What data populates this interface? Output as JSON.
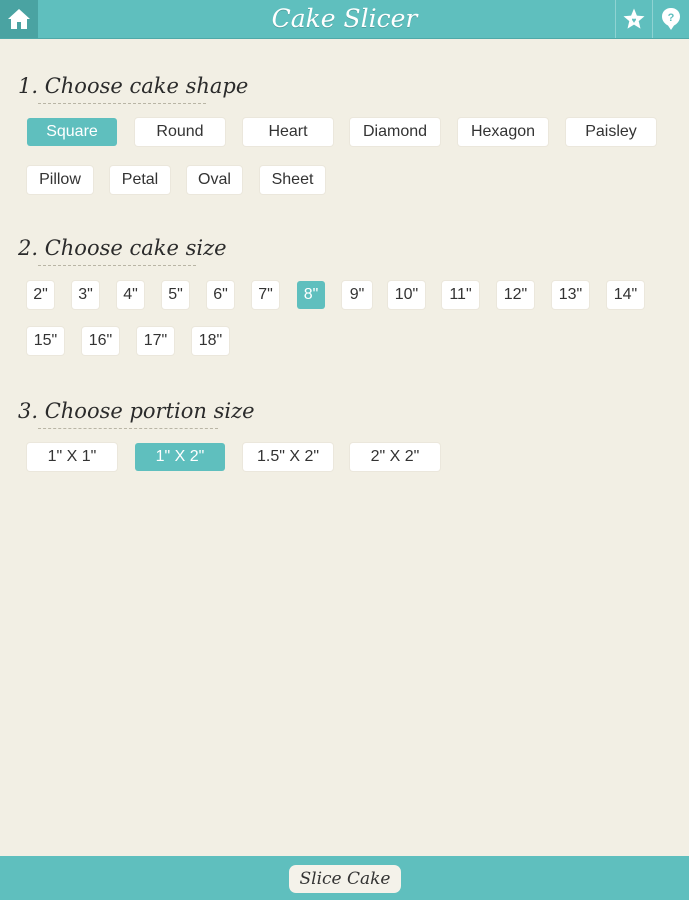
{
  "app": {
    "title": "Cake Slicer",
    "home_icon": "home-icon",
    "favorites_icon": "star-icon",
    "help_icon": "help-icon"
  },
  "colors": {
    "accent": "#5fbfbe",
    "background": "#f2efe4",
    "accent_dark": "#4aa3a2"
  },
  "shape": {
    "title": "1. Choose cake shape",
    "options": [
      "Square",
      "Round",
      "Heart",
      "Diamond",
      "Hexagon",
      "Paisley",
      "Pillow",
      "Petal",
      "Oval",
      "Sheet"
    ],
    "selected": "Square"
  },
  "size": {
    "title": "2. Choose cake size",
    "options": [
      "2\"",
      "3\"",
      "4\"",
      "5\"",
      "6\"",
      "7\"",
      "8\"",
      "9\"",
      "10\"",
      "11\"",
      "12\"",
      "13\"",
      "14\"",
      "15\"",
      "16\"",
      "17\"",
      "18\""
    ],
    "selected": "8\""
  },
  "portion": {
    "title": "3. Choose portion size",
    "options": [
      "1\" X 1\"",
      "1\" X 2\"",
      "1.5\" X 2\"",
      "2\" X 2\""
    ],
    "selected": "1\" X 2\""
  },
  "footer": {
    "slice_label": "Slice Cake"
  }
}
